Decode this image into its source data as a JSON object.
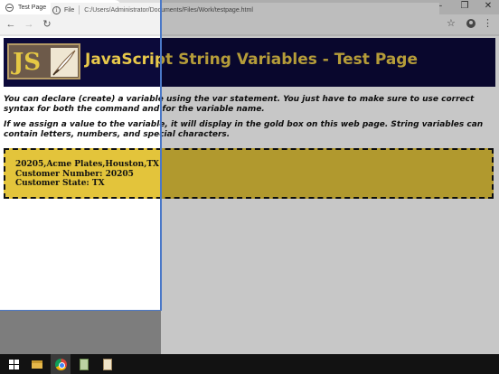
{
  "browser": {
    "tab_title": "Test Page",
    "tab_close": "×",
    "new_tab": "+",
    "window_controls": [
      "–",
      "❐",
      "✕"
    ],
    "back": "←",
    "forward": "→",
    "reload": "↻",
    "info": "i",
    "scheme": "File",
    "url": "C:/Users/Administrator/Documents/Files/Work/testpage.html",
    "star": "☆",
    "menu": "⋮"
  },
  "page": {
    "logo_text": "JS",
    "title": "JavaScript String Variables - Test Page",
    "paragraph1": "You can declare (create) a variable using the var statement. You just have to make sure to use correct syntax for both the command and for the variable name.",
    "paragraph2": "If we assign a value to the variable, it will display in the gold box on this web page. String variables can contain letters, numbers, and special characters.",
    "gold_box": {
      "line1": "20205,Acme Plates,Houston,TX",
      "line2": "Customer Number: 20205",
      "line3": "Customer State: TX"
    }
  },
  "colors": {
    "banner_bg": "#0c0a3a",
    "title_gold": "#e8c84a",
    "gold_box": "#e3c43b"
  },
  "taskbar": {
    "icons": [
      "windows-start-icon",
      "file-explorer-icon",
      "chrome-icon",
      "notepad-icon",
      "document-icon"
    ]
  }
}
